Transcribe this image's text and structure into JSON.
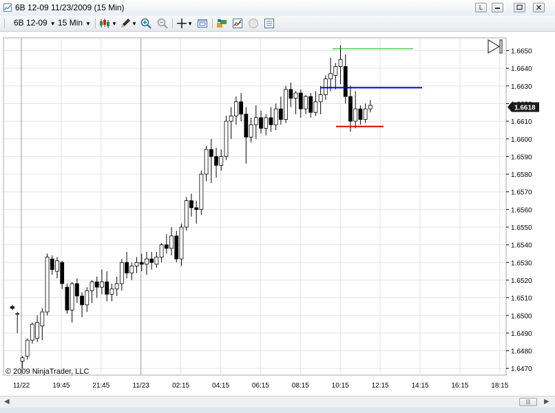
{
  "window": {
    "title": "6B 12-09  11/23/2009 (15 Min)",
    "btn_layout": "L"
  },
  "toolbar": {
    "instrument": "6B 12-09",
    "interval": "15 Min"
  },
  "chart_data": {
    "type": "candlestick",
    "copyright": "© 2009 NinjaTrader, LLC",
    "current_price": "1.6618",
    "y_ticks": [
      "1.6650",
      "1.6640",
      "1.6630",
      "1.6620",
      "1.6610",
      "1.6600",
      "1.6590",
      "1.6580",
      "1.6570",
      "1.6560",
      "1.6550",
      "1.6540",
      "1.6530",
      "1.6520",
      "1.6510",
      "1.6500",
      "1.6490",
      "1.6480",
      "1.6470"
    ],
    "x_ticks": [
      "11/22",
      "19:45",
      "21:45",
      "11/23",
      "02:15",
      "04:15",
      "06:15",
      "08:15",
      "10:15",
      "12:15",
      "14:15",
      "16:15",
      "18:15"
    ],
    "colors": {
      "up": "#ffffff",
      "down": "#000000",
      "green_line": "#00b000",
      "blue_line": "#0000c8",
      "red_line": "#e00000",
      "grid": "#e3e3e3"
    },
    "horizontal_lines": [
      {
        "color": "green",
        "price": 1.6651
      },
      {
        "color": "blue",
        "price": 1.6629
      },
      {
        "color": "red",
        "price": 1.6607
      }
    ],
    "candles": [
      [
        1.6505,
        1.6506,
        1.6503,
        1.6504
      ],
      [
        1.6501,
        1.6502,
        1.649,
        1.6501
      ],
      [
        1.6474,
        1.6477,
        1.647,
        1.6476
      ],
      [
        1.6477,
        1.6487,
        1.6475,
        1.6486
      ],
      [
        1.6486,
        1.6496,
        1.6484,
        1.6495
      ],
      [
        1.6487,
        1.65,
        1.6485,
        1.6496
      ],
      [
        1.6494,
        1.6504,
        1.6486,
        1.6502
      ],
      [
        1.6502,
        1.6535,
        1.65,
        1.6533
      ],
      [
        1.6532,
        1.6534,
        1.6523,
        1.6526
      ],
      [
        1.6525,
        1.6533,
        1.6521,
        1.6531
      ],
      [
        1.653,
        1.6531,
        1.6515,
        1.6518
      ],
      [
        1.6516,
        1.6518,
        1.6501,
        1.6503
      ],
      [
        1.6503,
        1.6519,
        1.6496,
        1.6518
      ],
      [
        1.6518,
        1.6521,
        1.6507,
        1.6511
      ],
      [
        1.6511,
        1.6513,
        1.6499,
        1.6506
      ],
      [
        1.6506,
        1.6516,
        1.6502,
        1.6514
      ],
      [
        1.6514,
        1.652,
        1.6507,
        1.6519
      ],
      [
        1.6519,
        1.6522,
        1.651,
        1.6516
      ],
      [
        1.6516,
        1.6526,
        1.6512,
        1.6519
      ],
      [
        1.6519,
        1.6525,
        1.6508,
        1.6512
      ],
      [
        1.6512,
        1.6518,
        1.6508,
        1.6515
      ],
      [
        1.6515,
        1.6522,
        1.6511,
        1.6518
      ],
      [
        1.6518,
        1.6532,
        1.6514,
        1.653
      ],
      [
        1.653,
        1.6536,
        1.6521,
        1.6524
      ],
      [
        1.6524,
        1.653,
        1.652,
        1.6528
      ],
      [
        1.6528,
        1.6533,
        1.6524,
        1.653
      ],
      [
        1.653,
        1.6535,
        1.6525,
        1.6529
      ],
      [
        1.6529,
        1.6536,
        1.6523,
        1.6532
      ],
      [
        1.6532,
        1.6536,
        1.6526,
        1.653
      ],
      [
        1.6529,
        1.6536,
        1.6527,
        1.6533
      ],
      [
        1.6533,
        1.6541,
        1.653,
        1.654
      ],
      [
        1.654,
        1.6546,
        1.6535,
        1.6538
      ],
      [
        1.6538,
        1.655,
        1.6534,
        1.6545
      ],
      [
        1.6545,
        1.6548,
        1.653,
        1.6532
      ],
      [
        1.6532,
        1.6552,
        1.6528,
        1.655
      ],
      [
        1.655,
        1.6567,
        1.6548,
        1.6565
      ],
      [
        1.6565,
        1.6569,
        1.6556,
        1.6561
      ],
      [
        1.6561,
        1.6565,
        1.6552,
        1.656
      ],
      [
        1.656,
        1.6582,
        1.6557,
        1.658
      ],
      [
        1.658,
        1.6596,
        1.6576,
        1.6594
      ],
      [
        1.6594,
        1.66,
        1.6575,
        1.659
      ],
      [
        1.659,
        1.6595,
        1.6578,
        1.6585
      ],
      [
        1.6585,
        1.6594,
        1.6582,
        1.659
      ],
      [
        1.659,
        1.6613,
        1.6588,
        1.661
      ],
      [
        1.661,
        1.6618,
        1.66,
        1.6613
      ],
      [
        1.6613,
        1.6624,
        1.6608,
        1.6621
      ],
      [
        1.6621,
        1.6626,
        1.661,
        1.6614
      ],
      [
        1.6614,
        1.6618,
        1.6586,
        1.6601
      ],
      [
        1.6601,
        1.6612,
        1.6598,
        1.6608
      ],
      [
        1.6608,
        1.6619,
        1.66,
        1.6612
      ],
      [
        1.6612,
        1.6616,
        1.6603,
        1.6606
      ],
      [
        1.6606,
        1.6614,
        1.6602,
        1.6612
      ],
      [
        1.6612,
        1.6618,
        1.6604,
        1.6608
      ],
      [
        1.6608,
        1.662,
        1.6605,
        1.6617
      ],
      [
        1.6617,
        1.6624,
        1.6608,
        1.6611
      ],
      [
        1.6611,
        1.663,
        1.6609,
        1.6628
      ],
      [
        1.6628,
        1.6632,
        1.6618,
        1.6623
      ],
      [
        1.6623,
        1.6627,
        1.6614,
        1.6626
      ],
      [
        1.6626,
        1.6628,
        1.6612,
        1.6617
      ],
      [
        1.6617,
        1.6625,
        1.6614,
        1.6624
      ],
      [
        1.6624,
        1.6626,
        1.6612,
        1.6615
      ],
      [
        1.6615,
        1.6627,
        1.6613,
        1.6621
      ],
      [
        1.6621,
        1.663,
        1.6614,
        1.6625
      ],
      [
        1.6625,
        1.6636,
        1.6622,
        1.6634
      ],
      [
        1.6634,
        1.6646,
        1.6627,
        1.6637
      ],
      [
        1.6636,
        1.6643,
        1.6628,
        1.6641
      ],
      [
        1.6641,
        1.6653,
        1.6631,
        1.6645
      ],
      [
        1.6641,
        1.6648,
        1.662,
        1.6624
      ],
      [
        1.6624,
        1.663,
        1.6604,
        1.661
      ],
      [
        1.661,
        1.6627,
        1.6606,
        1.6617
      ],
      [
        1.6617,
        1.6619,
        1.6608,
        1.6611
      ],
      [
        1.6611,
        1.662,
        1.6609,
        1.6617
      ],
      [
        1.6617,
        1.6622,
        1.6615,
        1.6619
      ]
    ]
  }
}
